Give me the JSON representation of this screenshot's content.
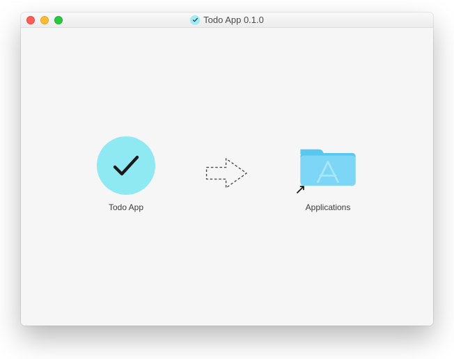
{
  "window": {
    "title": "Todo App 0.1.0"
  },
  "installer": {
    "app_label": "Todo App",
    "target_label": "Applications"
  }
}
